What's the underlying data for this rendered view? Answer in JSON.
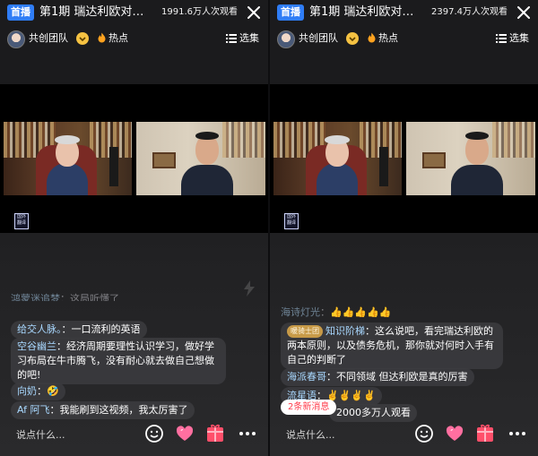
{
  "panels": [
    {
      "header": {
        "badge": "首播",
        "title": "第1期 瑞达利欧对话…",
        "viewers": "1991.6万人次观看"
      },
      "author": {
        "name": "共创团队",
        "hot_label": "热点",
        "select_label": "选集"
      },
      "watermark": "国外翻译",
      "chat_partial": {
        "nick": "鸿蒙迷追梦",
        "text": "：这局听懂了"
      },
      "chat": [
        {
          "nick": "给交人脉。",
          "text": "：一口流利的英语"
        },
        {
          "nick": "空谷幽兰",
          "text": "：经济周期要理性认识学习，做好学习布局在牛市腾飞，没有耐心就去做自己想做的吧!"
        },
        {
          "nick": "向奶",
          "text": "：🤣"
        },
        {
          "nick": "Af 阿飞",
          "text": "：我能刷到这视频，我太厉害了"
        }
      ],
      "input_placeholder": "说点什么..."
    },
    {
      "header": {
        "badge": "首播",
        "title": "第1期 瑞达利欧对话…",
        "viewers": "2397.4万人次观看"
      },
      "author": {
        "name": "共创团队",
        "hot_label": "热点",
        "select_label": "选集"
      },
      "watermark": "国外翻译",
      "chat_partial": {
        "nick": "海诗灯光",
        "text": "：👍👍👍👍👍"
      },
      "chat": [
        {
          "badge": "暖骑士团",
          "nick": "知识阶梯",
          "text": "：这么说吧，看完瑞达利欧的两本原则，以及债务危机，那你就对何时入手有自己的判断了"
        },
        {
          "nick": "海派春哥",
          "text": "：不同领域 但达利欧是真的厉害"
        },
        {
          "nick": "流星语",
          "text": "：✌️✌️✌️✌️"
        },
        {
          "text": "2000多万人观看"
        }
      ],
      "new_messages": "2条新消息",
      "input_placeholder": "说点什么..."
    }
  ],
  "icons": {
    "close": "close-icon",
    "chevron": "chevron-down-icon",
    "hot": "flame-icon",
    "select": "list-icon",
    "emoji": "smiley-icon",
    "like": "heart-icon",
    "gift": "gift-icon",
    "more": "more-dots-icon"
  },
  "colors": {
    "live_badge": "#2f7df6",
    "nick": "#a9d8ff",
    "gift": "#ff4f6a",
    "new_msg_text": "#ff3b4a",
    "level_badge": "#c79a48"
  }
}
